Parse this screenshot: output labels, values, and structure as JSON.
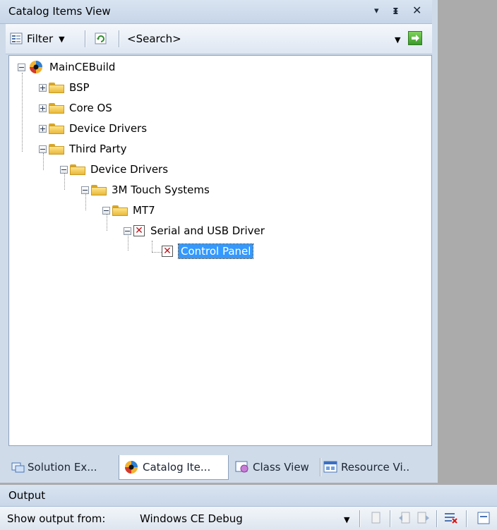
{
  "panel": {
    "title": "Catalog Items View",
    "dropdown_glyph": "▾",
    "pin_glyph": "ᵻ",
    "close_glyph": "✕"
  },
  "toolbar": {
    "filter_label": "Filter",
    "search_value": "<Search>"
  },
  "tree": {
    "items": [
      {
        "label": "MainCEBuild",
        "icon": "catalog-root-icon",
        "expanded": true
      },
      {
        "label": "BSP",
        "icon": "folder-icon",
        "expanded": false
      },
      {
        "label": "Core OS",
        "icon": "folder-icon",
        "expanded": false
      },
      {
        "label": "Device Drivers",
        "icon": "folder-icon",
        "expanded": false
      },
      {
        "label": "Third Party",
        "icon": "folder-icon",
        "expanded": true
      },
      {
        "label": "Device Drivers",
        "icon": "folder-icon",
        "expanded": true
      },
      {
        "label": "3M Touch Systems",
        "icon": "folder-icon",
        "expanded": true
      },
      {
        "label": "MT7",
        "icon": "folder-icon",
        "expanded": true
      },
      {
        "label": "Serial and USB Driver",
        "icon": "unchecked-x-icon",
        "expanded": true
      },
      {
        "label": "Control Panel",
        "icon": "unchecked-x-icon",
        "selected": true
      }
    ]
  },
  "tabs": [
    {
      "label": "Solution Ex...",
      "icon": "solution-explorer-icon"
    },
    {
      "label": "Catalog Ite...",
      "icon": "catalog-icon",
      "active": true
    },
    {
      "label": "Class View",
      "icon": "class-view-icon"
    },
    {
      "label": "Resource Vi..",
      "icon": "resource-view-icon"
    }
  ],
  "output": {
    "title": "Output",
    "show_from_label": "Show output from:",
    "source_value": "Windows CE Debug"
  },
  "colors": {
    "selection": "#3399ff",
    "x_mark": "#c0131b",
    "panel_bg": "#cfdbe9"
  }
}
